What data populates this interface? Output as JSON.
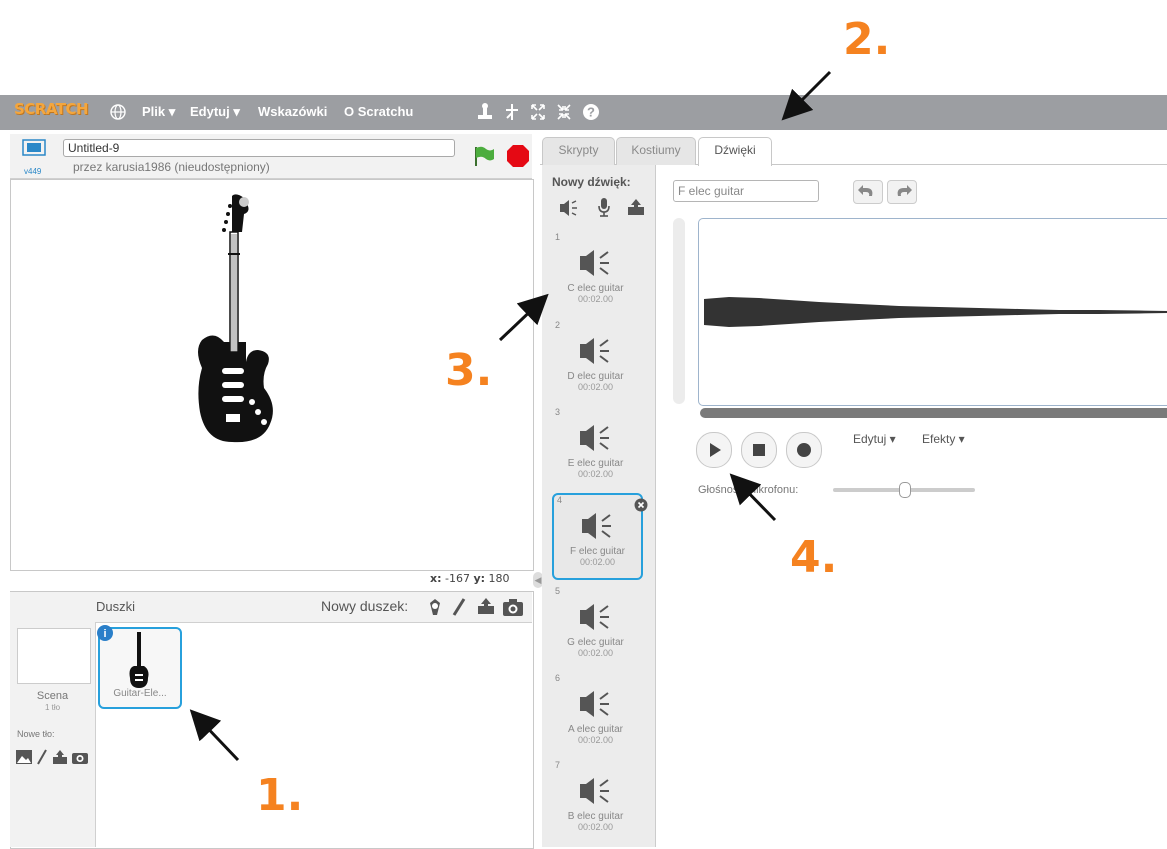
{
  "menubar": {
    "logo": "SCRATCH",
    "globe_icon": "globe-icon",
    "file": "Plik",
    "edit": "Edytuj",
    "tips": "Wskazówki",
    "about": "O Scratchu",
    "tool_icons": [
      "duplicate-icon",
      "cut-icon",
      "grow-icon",
      "shrink-icon",
      "help-icon"
    ]
  },
  "stage": {
    "project_title": "Untitled-9",
    "version": "v449",
    "author": "przez karusia1986 (nieudostępniony)",
    "coords": {
      "x_label": "x:",
      "x": "-167",
      "y_label": "y:",
      "y": "180"
    }
  },
  "sprites": {
    "header": "Duszki",
    "new_sprite": "Nowy duszek:",
    "scene_label": "Scena",
    "scene_sub": "1 tło",
    "new_backdrop": "Nowe tło:",
    "sprite_name": "Guitar-Ele..."
  },
  "tabs": [
    "Skrypty",
    "Kostiumy",
    "Dźwięki"
  ],
  "sounds": {
    "new_sound": "Nowy dźwięk:",
    "items": [
      {
        "num": "1",
        "name": "C elec guitar",
        "dur": "00:02.00"
      },
      {
        "num": "2",
        "name": "D elec guitar",
        "dur": "00:02.00"
      },
      {
        "num": "3",
        "name": "E elec guitar",
        "dur": "00:02.00"
      },
      {
        "num": "4",
        "name": "F elec guitar",
        "dur": "00:02.00"
      },
      {
        "num": "5",
        "name": "G elec guitar",
        "dur": "00:02.00"
      },
      {
        "num": "6",
        "name": "A elec guitar",
        "dur": "00:02.00"
      },
      {
        "num": "7",
        "name": "B elec guitar",
        "dur": "00:02.00"
      }
    ]
  },
  "editor": {
    "sound_name": "F elec guitar",
    "edit_menu": "Edytuj ▾",
    "effects_menu": "Efekty ▾",
    "mic_volume": "Głośność mikrofonu:",
    "mic_level": 0.5
  },
  "annotations": [
    "1.",
    "2.",
    "3.",
    "4."
  ],
  "colors": {
    "menubar": "#9c9ea2",
    "accent": "#27a0dc",
    "annotation": "#f58220"
  }
}
